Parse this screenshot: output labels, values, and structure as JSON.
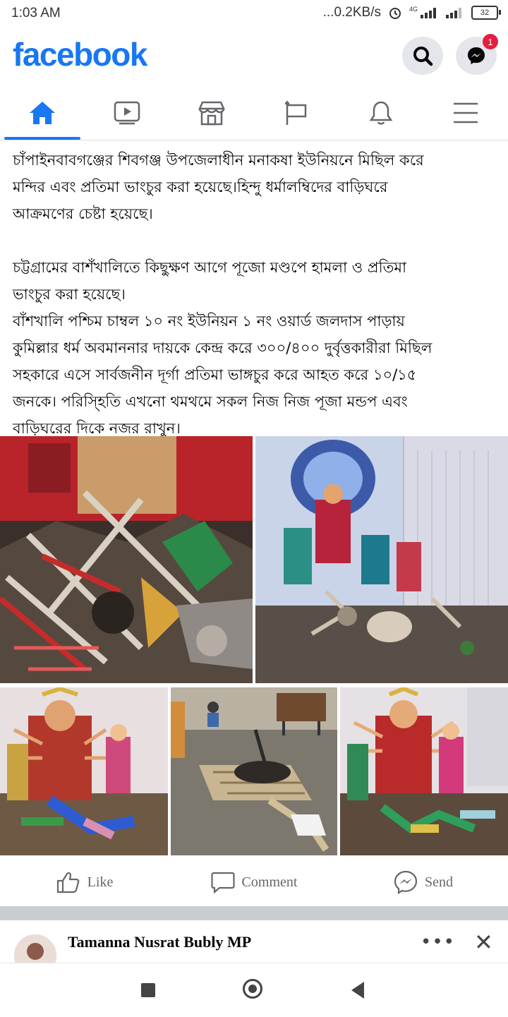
{
  "status_bar": {
    "time": "1:03 AM",
    "network_speed": "...0.2KB/s",
    "network_type": "4G",
    "battery": "32"
  },
  "header": {
    "logo": "facebook",
    "messenger_badge": "1"
  },
  "tabs": [
    {
      "icon": "home-icon",
      "active": true
    },
    {
      "icon": "video-icon",
      "active": false
    },
    {
      "icon": "marketplace-icon",
      "active": false
    },
    {
      "icon": "flag-icon",
      "active": false
    },
    {
      "icon": "bell-icon",
      "active": false
    },
    {
      "icon": "menu-icon",
      "active": false
    }
  ],
  "post": {
    "lines_p1": [
      "চাঁপাইনবাবগঞ্জের শিবগঞ্জ উপজেলাধীন মনাকষা ইউনিয়নে মিছিল করে",
      "মন্দির এবং প্রতিমা ভাংচুর করা হয়েছে।হিন্দু ধর্মালম্বিদের বাড়িঘরে",
      "আক্রমণের চেষ্টা হয়েছে।"
    ],
    "lines_p2": [
      "চট্টগ্রামের বাশঁখালিতে কিছুক্ষণ আগে পূজো মণ্ডপে হামলা ও প্রতিমা",
      "ভাংচুর করা হয়েছে।",
      "বাঁশখালি পশ্চিম চাম্বল ১০ নং ইউনিয়ন ১ নং ওয়ার্ড জলদাস পাড়ায়",
      "কুমিল্লার ধর্ম অবমাননার দায়কে কেন্দ্র করে ৩০০/৪০০ দুর্বৃত্তকারীরা মিছিল",
      "সহকারে এসে সার্বজনীন দূর্গা প্রতিমা ভাঙ্গচুর করে আহত করে ১০/১৫",
      "জনকে। পরিস্হিতি এখনো থমথমে সকল নিজ নিজ পূজা মন্ডপ এবং",
      "বাড়িঘরের দিকে নজর রাখুন।"
    ]
  },
  "actions": {
    "like": "Like",
    "comment": "Comment",
    "send": "Send"
  },
  "next_post": {
    "author": "Tamanna Nusrat Bubly MP",
    "more": "•••",
    "close": "✕"
  },
  "colors": {
    "brand": "#1877f2",
    "badge": "#e41e3f",
    "text": "#050505",
    "muted": "#65676b"
  }
}
